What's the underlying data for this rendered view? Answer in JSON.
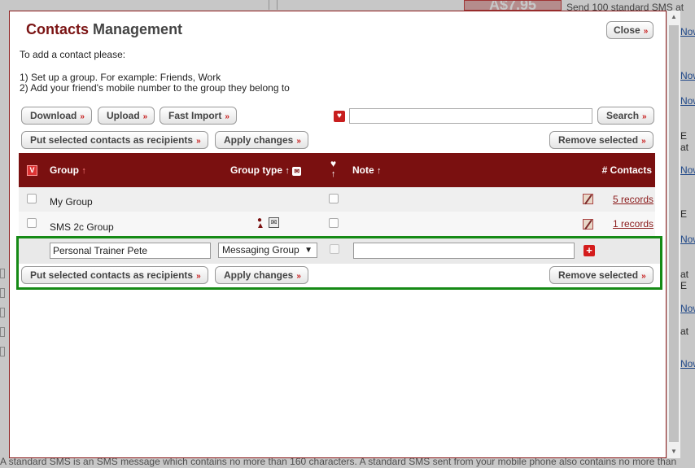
{
  "background": {
    "price": "A$7.95",
    "side_text": "Send 100 standard SMS at",
    "side_links": [
      "Now",
      "Now",
      "Now",
      "Now",
      "Now",
      "Now",
      "Now"
    ],
    "side_letters": [
      "E",
      "at",
      "E",
      "at",
      "E",
      "at"
    ],
    "bottom_text": "A standard SMS is an SMS message which contains no more than 160 characters. A standard SMS sent from your mobile phone also contains no more than"
  },
  "modal": {
    "title_accent": "Contacts",
    "title_rest": "Management",
    "close_label": "Close",
    "intro_line": "To add a contact please:",
    "step1": "1) Set up a group. For example: Friends, Work",
    "step2": "2) Add your friend's mobile number to the group they belong to",
    "toolbar": {
      "download": "Download",
      "upload": "Upload",
      "fast_import": "Fast Import",
      "search": "Search",
      "search_value": "",
      "put_selected": "Put selected contacts as recipients",
      "apply_changes": "Apply changes",
      "remove_selected": "Remove selected"
    },
    "table": {
      "select_all": "V",
      "col_group": "Group",
      "col_group_type": "Group type",
      "col_note": "Note",
      "col_contacts": "# Contacts",
      "rows": [
        {
          "group": "My Group",
          "contacts": "5 records"
        },
        {
          "group": "SMS 2c Group",
          "contacts": "1 records"
        }
      ]
    },
    "new_group": {
      "name_value": "Personal Trainer Pete",
      "type_value": "Messaging Group",
      "note_value": "",
      "put_selected": "Put selected contacts as recipients",
      "apply_changes": "Apply changes",
      "remove_selected": "Remove selected"
    }
  }
}
